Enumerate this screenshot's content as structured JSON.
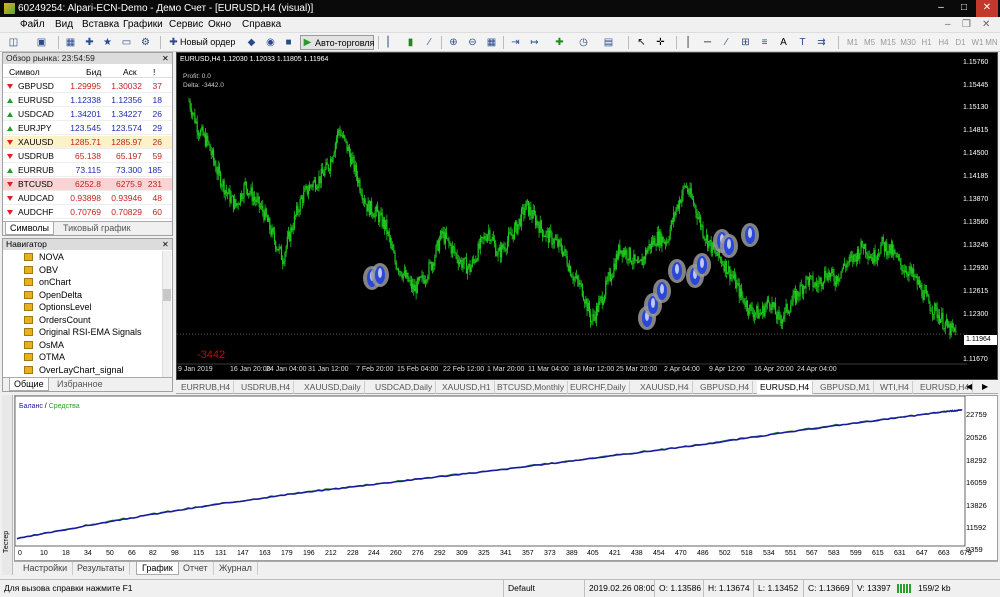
{
  "titlebar": {
    "text": "60249254: Alpari-ECN-Demo - Демо Счет - [EURUSD,H4 (visual)]"
  },
  "menu": [
    "Файл",
    "Вид",
    "Вставка",
    "Графики",
    "Сервис",
    "Окно",
    "Справка"
  ],
  "toolbar": {
    "new_order": "Новый ордер",
    "autotrading": "Авто-торговля",
    "timeframes": [
      "M1",
      "M5",
      "M15",
      "M30",
      "H1",
      "H4",
      "D1",
      "W1",
      "MN"
    ]
  },
  "market_watch": {
    "header": "Обзор рынка: 23:54:59",
    "columns": {
      "symbol": "Символ",
      "bid": "Бид",
      "ask": "Аск",
      "spread": "!"
    },
    "rows": [
      {
        "symbol": "GBPUSD",
        "bid": "1.29995",
        "ask": "1.30032",
        "spread": "37",
        "dir": "dn"
      },
      {
        "symbol": "EURUSD",
        "bid": "1.12338",
        "ask": "1.12356",
        "spread": "18",
        "dir": "up"
      },
      {
        "symbol": "USDCAD",
        "bid": "1.34201",
        "ask": "1.34227",
        "spread": "26",
        "dir": "up"
      },
      {
        "symbol": "EURJPY",
        "bid": "123.545",
        "ask": "123.574",
        "spread": "29",
        "dir": "up"
      },
      {
        "symbol": "XAUUSD",
        "bid": "1285.71",
        "ask": "1285.97",
        "spread": "26",
        "dir": "dn"
      },
      {
        "symbol": "USDRUB",
        "bid": "65.138",
        "ask": "65.197",
        "spread": "59",
        "dir": "dn"
      },
      {
        "symbol": "EURRUB",
        "bid": "73.115",
        "ask": "73.300",
        "spread": "185",
        "dir": "up"
      },
      {
        "symbol": "BTCUSD",
        "bid": "6252.8",
        "ask": "6275.9",
        "spread": "231",
        "dir": "dn"
      },
      {
        "symbol": "AUDCAD",
        "bid": "0.93898",
        "ask": "0.93946",
        "spread": "48",
        "dir": "dn"
      },
      {
        "symbol": "AUDCHF",
        "bid": "0.70769",
        "ask": "0.70829",
        "spread": "60",
        "dir": "dn"
      }
    ],
    "tabs": [
      "Символы",
      "Тиковый график"
    ]
  },
  "navigator": {
    "header": "Навигатор",
    "items": [
      "NOVA",
      "OBV",
      "onChart",
      "OpenDelta",
      "OptionsLevel",
      "OrdersCount",
      "Original RSI-EMA Signals",
      "OsMA",
      "OTMA",
      "OverLayChart_signal"
    ],
    "tabs": [
      "Общие",
      "Избранное"
    ]
  },
  "chart": {
    "title": "EURUSD,H4  1.12030  1.12033  1.11805  1.11964",
    "info1": "Profit: 0.0",
    "info2": "Delta: -3442.0",
    "delta_label": "-3442",
    "current_price": "1.11964",
    "price_labels": [
      "1.15760",
      "1.15445",
      "1.15130",
      "1.14815",
      "1.14500",
      "1.14185",
      "1.13870",
      "1.13560",
      "1.13245",
      "1.12930",
      "1.12615",
      "1.12300",
      "1.11964",
      "1.11670"
    ],
    "time_labels": [
      "9 Jan 2019",
      "16 Jan 20:00",
      "24 Jan 04:00",
      "31 Jan 12:00",
      "7 Feb 20:00",
      "15 Feb 04:00",
      "22 Feb 12:00",
      "1 Mar 20:00",
      "11 Mar 04:00",
      "18 Mar 12:00",
      "25 Mar 20:00",
      "2 Apr 04:00",
      "9 Apr 12:00",
      "16 Apr 20:00",
      "24 Apr 04:00"
    ],
    "price_range": [
      1.1155,
      1.1592
    ],
    "close_series": [
      1.153,
      1.149,
      1.147,
      1.143,
      1.14,
      1.138,
      1.141,
      1.139,
      1.137,
      1.1335,
      1.1305,
      1.135,
      1.139,
      1.141,
      1.142,
      1.144,
      1.149,
      1.146,
      1.142,
      1.138,
      1.137,
      1.135,
      1.13,
      1.128,
      1.126,
      1.1275,
      1.13,
      1.134,
      1.132,
      1.13,
      1.129,
      1.132,
      1.1345,
      1.131,
      1.133,
      1.135,
      1.138,
      1.136,
      1.134,
      1.133,
      1.1315,
      1.128,
      1.126,
      1.1215,
      1.1245,
      1.128,
      1.132,
      1.131,
      1.129,
      1.132,
      1.1335,
      1.133,
      1.1375,
      1.141,
      1.138,
      1.134,
      1.1315,
      1.13,
      1.128,
      1.125,
      1.123,
      1.1225,
      1.1245,
      1.1215,
      1.1235,
      1.1255,
      1.1275,
      1.1265,
      1.1285,
      1.1275,
      1.1295,
      1.1305,
      1.1325,
      1.1305,
      1.1325,
      1.1315,
      1.1295,
      1.1285,
      1.1265,
      1.124,
      1.1225,
      1.1205,
      1.1196
    ]
  },
  "chart_tabs": [
    "EURRUB,H4",
    "USDRUB,H4",
    "XAUUSD,Daily",
    "USDCAD,Daily",
    "XAUUSD,H1",
    "BTCUSD,Monthly",
    "EURCHF,Daily",
    "XAUUSD,H4",
    "GBPUSD,H4",
    "EURUSD,H4",
    "GBPUSD,M1",
    "WTI,H4",
    "EURUSD,H4"
  ],
  "tester": {
    "legend_balance": "Баланс",
    "legend_sep": " / ",
    "legend_equity": "Средства",
    "side_label": "Тестер",
    "y_labels": [
      "22759",
      "20526",
      "18292",
      "16059",
      "13826",
      "11592",
      "9359"
    ],
    "x_labels": [
      "0",
      "10",
      "18",
      "34",
      "50",
      "66",
      "82",
      "98",
      "115",
      "131",
      "147",
      "163",
      "179",
      "196",
      "212",
      "228",
      "244",
      "260",
      "276",
      "292",
      "309",
      "325",
      "341",
      "357",
      "373",
      "389",
      "405",
      "421",
      "438",
      "454",
      "470",
      "486",
      "502",
      "518",
      "534",
      "551",
      "567",
      "583",
      "599",
      "615",
      "631",
      "647",
      "663",
      "679"
    ],
    "tabs": [
      "Настройки",
      "Результаты",
      "График",
      "Отчет",
      "Журнал"
    ],
    "chart_data": {
      "type": "line",
      "ylim": [
        8800,
        23300
      ],
      "series": [
        {
          "name": "Баланс",
          "color": "#1a1a9e"
        },
        {
          "name": "Средства",
          "color": "#2aa02a"
        }
      ],
      "x": [
        0,
        50,
        100,
        150,
        200,
        250,
        300,
        350,
        400,
        450,
        500,
        550,
        600,
        650,
        679,
        690
      ],
      "balance": [
        9359,
        10700,
        11950,
        13050,
        14050,
        14900,
        15750,
        16550,
        17450,
        18350,
        19250,
        20300,
        21300,
        22200,
        22750,
        22870
      ]
    }
  },
  "status": {
    "help": "Для вызова справки нажмите F1",
    "profile": "Default",
    "datetime": "2019.02.26 08:00",
    "open": "O: 1.13586",
    "high": "H: 1.13674",
    "low": "L: 1.13452",
    "close": "C: 1.13669",
    "volume": "V: 13397",
    "traffic": "159/2 kb"
  },
  "colors": {
    "bull": "#1ec81e",
    "bg": "#000000",
    "balance": "#1a1a9e",
    "equity": "#2aa02a"
  }
}
